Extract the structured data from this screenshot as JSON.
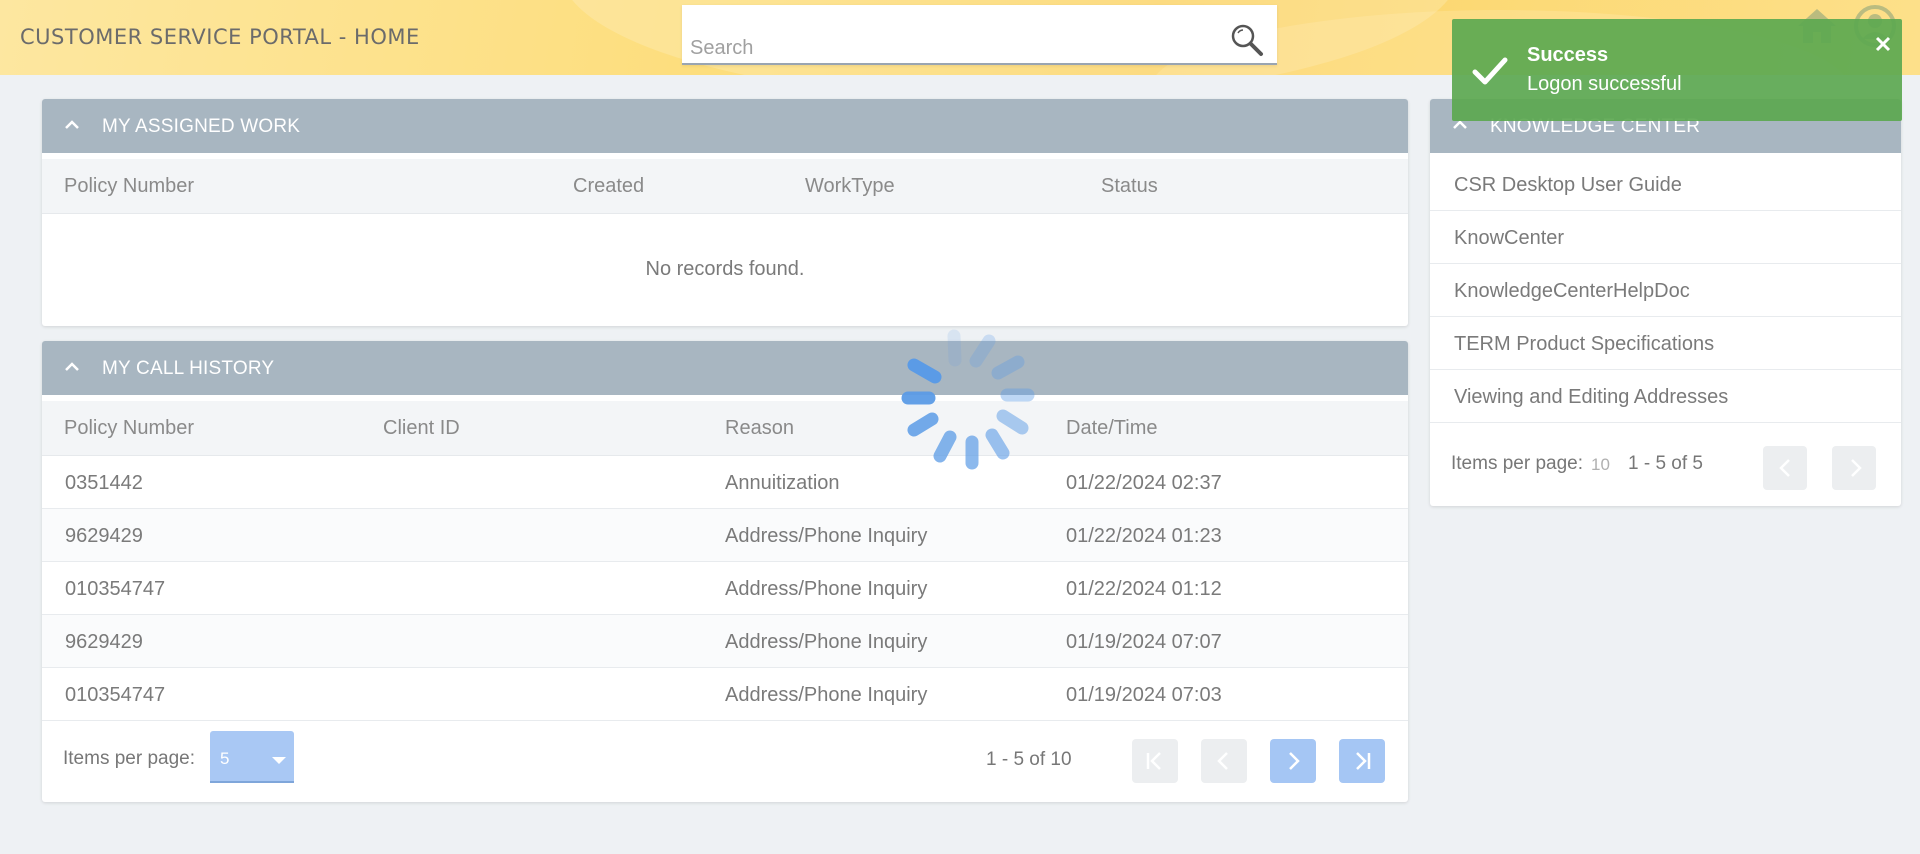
{
  "header": {
    "title": "CUSTOMER SERVICE PORTAL - HOME",
    "search_placeholder": "Search"
  },
  "assigned_work": {
    "title": "MY ASSIGNED WORK",
    "columns": [
      "Policy Number",
      "Created",
      "WorkType",
      "Status"
    ],
    "empty_message": "No records found."
  },
  "call_history": {
    "title": "MY CALL HISTORY",
    "columns": [
      "Policy Number",
      "Client ID",
      "Reason",
      "Date/Time"
    ],
    "rows": [
      {
        "policy": "0351442",
        "client_id": "",
        "reason": "Annuitization",
        "datetime": "01/22/2024 02:37"
      },
      {
        "policy": "9629429",
        "client_id": "",
        "reason": "Address/Phone Inquiry",
        "datetime": "01/22/2024 01:23"
      },
      {
        "policy": "010354747",
        "client_id": "",
        "reason": "Address/Phone Inquiry",
        "datetime": "01/22/2024 01:12"
      },
      {
        "policy": "9629429",
        "client_id": "",
        "reason": "Address/Phone Inquiry",
        "datetime": "01/19/2024 07:07"
      },
      {
        "policy": "010354747",
        "client_id": "",
        "reason": "Address/Phone Inquiry",
        "datetime": "01/19/2024 07:03"
      }
    ],
    "items_per_page_label": "Items per page:",
    "items_per_page_value": "5",
    "range_text": "1 - 5 of 10"
  },
  "knowledge_center": {
    "title": "KNOWLEDGE CENTER",
    "items": [
      "CSR Desktop User Guide",
      "KnowCenter",
      "KnowledgeCenterHelpDoc",
      "TERM Product Specifications",
      "Viewing and Editing Addresses"
    ],
    "items_per_page_label": "Items per page:",
    "items_per_page_value": "10",
    "range_text": "1 - 5 of 5"
  },
  "toast": {
    "title": "Success",
    "message": "Logon successful"
  },
  "colors": {
    "panel_header": "#a8b6c1",
    "toast_green": "#5ca850",
    "pager_active": "#a5c6f4",
    "spinner_blue": "#5b9be6"
  }
}
